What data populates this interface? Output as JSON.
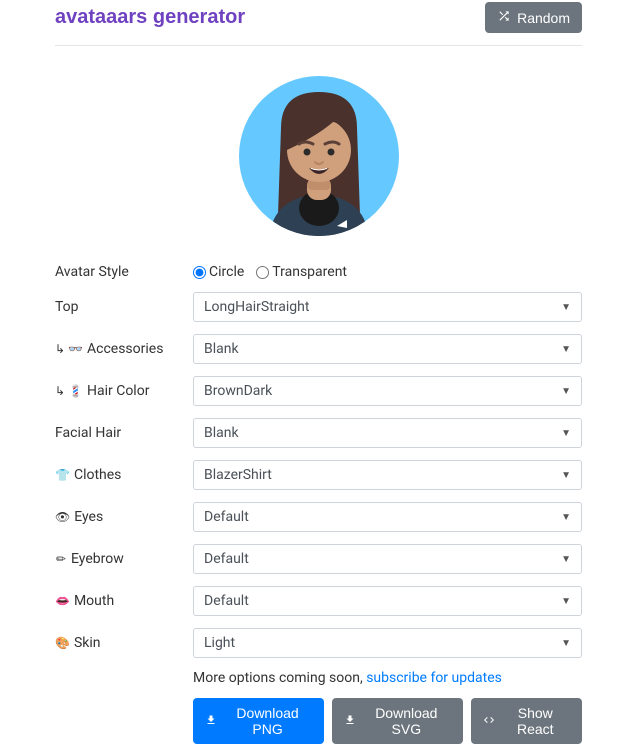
{
  "header": {
    "title": "avataaars generator",
    "random_label": "Random"
  },
  "avatar_style": {
    "label": "Avatar Style",
    "options": [
      "Circle",
      "Transparent"
    ],
    "selected": "Circle"
  },
  "fields": [
    {
      "icon": "",
      "label": "Top",
      "value": "LongHairStraight"
    },
    {
      "icon": "↳ 👓",
      "label": "Accessories",
      "value": "Blank"
    },
    {
      "icon": "↳ 💈",
      "label": "Hair Color",
      "value": "BrownDark"
    },
    {
      "icon": "",
      "label": "Facial Hair",
      "value": "Blank"
    },
    {
      "icon": "👕",
      "label": "Clothes",
      "value": "BlazerShirt"
    },
    {
      "icon": "👁",
      "label": "Eyes",
      "value": "Default"
    },
    {
      "icon": "✏",
      "label": "Eyebrow",
      "value": "Default"
    },
    {
      "icon": "👄",
      "label": "Mouth",
      "value": "Default"
    },
    {
      "icon": "🎨",
      "label": "Skin",
      "value": "Light"
    }
  ],
  "footer": {
    "note_prefix": "More options coming soon, ",
    "subscribe_text": "subscribe for updates",
    "download_png": "Download PNG",
    "download_svg": "Download SVG",
    "show_react": "Show React"
  },
  "colors": {
    "circle_bg": "#65C9FF",
    "skin": "#D0A07D",
    "hair": "#4A312C",
    "clothes": "#2E4053"
  }
}
